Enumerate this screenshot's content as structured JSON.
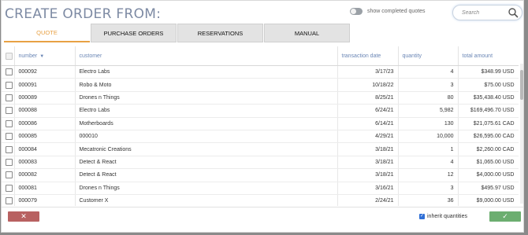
{
  "header": {
    "title": "CREATE ORDER FROM:",
    "toggle_label": "show completed quotes",
    "search_placeholder": "Search"
  },
  "tabs": [
    {
      "label": "QUOTE",
      "active": true
    },
    {
      "label": "PURCHASE ORDERS",
      "active": false
    },
    {
      "label": "RESERVATIONS",
      "active": false
    },
    {
      "label": "MANUAL",
      "active": false
    }
  ],
  "table": {
    "columns": [
      "number",
      "customer",
      "transaction date",
      "quantity",
      "total amount"
    ],
    "rows": [
      {
        "number": "000092",
        "customer": "Electro Labs",
        "date": "3/17/23",
        "quantity": "4",
        "total": "$348.99 USD"
      },
      {
        "number": "000091",
        "customer": "Robo & Moto",
        "date": "10/18/22",
        "quantity": "3",
        "total": "$75.00 USD"
      },
      {
        "number": "000089",
        "customer": "Drones n Things",
        "date": "8/25/21",
        "quantity": "80",
        "total": "$35,438.40 USD"
      },
      {
        "number": "000088",
        "customer": "Electro Labs",
        "date": "6/24/21",
        "quantity": "5,982",
        "total": "$169,496.70 USD"
      },
      {
        "number": "000086",
        "customer": "Motherboards",
        "date": "6/14/21",
        "quantity": "130",
        "total": "$21,075.61 CAD"
      },
      {
        "number": "000085",
        "customer": "000010",
        "date": "4/29/21",
        "quantity": "10,000",
        "total": "$26,595.00 CAD"
      },
      {
        "number": "000084",
        "customer": "Mecatronic Creations",
        "date": "3/18/21",
        "quantity": "1",
        "total": "$2,260.00 CAD"
      },
      {
        "number": "000083",
        "customer": "Detect & React",
        "date": "3/18/21",
        "quantity": "4",
        "total": "$1,065.00 USD"
      },
      {
        "number": "000082",
        "customer": "Detect & React",
        "date": "3/18/21",
        "quantity": "12",
        "total": "$4,000.00 USD"
      },
      {
        "number": "000081",
        "customer": "Drones n Things",
        "date": "3/16/21",
        "quantity": "3",
        "total": "$495.97 USD"
      },
      {
        "number": "000079",
        "customer": "Customer X",
        "date": "2/24/21",
        "quantity": "36",
        "total": "$9,000.00 USD"
      }
    ]
  },
  "footer": {
    "cancel_symbol": "✕",
    "inherit_label": "inherit quantities",
    "inherit_checked": true,
    "ok_symbol": "✓"
  },
  "colors": {
    "accent": "#e8a144",
    "cancel": "#b86161",
    "ok": "#6cae70",
    "header_text": "#6a86b5"
  }
}
